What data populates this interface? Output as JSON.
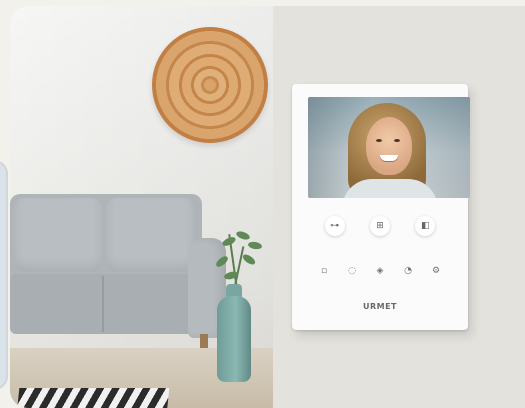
{
  "scene": {
    "colors": {
      "wall": "#f6f6f4",
      "sofa": "#aeb4b8",
      "panel": "#e4e2dc",
      "vase": "#7aa6a1",
      "basket": "#d9a36a"
    }
  },
  "device": {
    "brand": "URMET",
    "top_buttons": [
      {
        "icon": "key-icon",
        "glyph": "⊶"
      },
      {
        "icon": "gate-icon",
        "glyph": "⊞"
      },
      {
        "icon": "door-open-icon",
        "glyph": "◧"
      }
    ],
    "bottom_buttons": [
      {
        "icon": "light-icon",
        "glyph": "▫"
      },
      {
        "icon": "bell-icon",
        "glyph": "◌"
      },
      {
        "icon": "mute-icon",
        "glyph": "◈"
      },
      {
        "icon": "intercom-icon",
        "glyph": "◔"
      },
      {
        "icon": "settings-icon",
        "glyph": "⚙"
      }
    ]
  }
}
